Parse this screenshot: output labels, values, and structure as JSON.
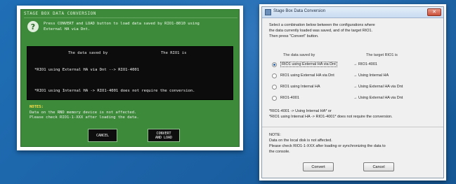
{
  "left_panel": {
    "title": "STAGE BOX DATA CONVERSION",
    "help_icon_glyph": "?",
    "instruction_lines": [
      "Press CONVERT and LOAD button to load data saved by RIO1-8010 using",
      "External HA via Dnt."
    ],
    "col_saved": "The data saved by",
    "col_target": "The RIO1 is",
    "black_lines": [
      "*RIO1 using External HA via Dnt  -->  RIO1-4001",
      "*RIO1 using Internal HA  -> RIO1-4001 does not require the conversion."
    ],
    "notes_heading": "NOTES:",
    "notes": [
      "Data on the RND memory device is not affected.",
      "Please check RIO1-1-XXX after loading the data."
    ],
    "buttons": {
      "cancel": "CANCEL",
      "convert_line1": "CONVERT",
      "convert_line2": "AND LOAD"
    }
  },
  "dialog": {
    "title": "Stage Box Data Conversion",
    "close_glyph": "✕",
    "instruction_lines": [
      "Select a combination below between the configurations where",
      "the data currently loaded was saved, and of the target RIO1.",
      "Then press \"Convert\" button."
    ],
    "col_saved": "The data saved by",
    "col_target": "The target RIO1 is",
    "options": [
      {
        "saved": "RIO1 using External HA via Dnt",
        "target": "→ RIO1-4001",
        "selected": true
      },
      {
        "saved": "RIO1 using External HA via Dnt",
        "target": "→ Using Internal HA",
        "selected": false
      },
      {
        "saved": "RIO1 using Internal HA",
        "target": "→ Using External HA via Dnt",
        "selected": false
      },
      {
        "saved": "RIO1-4001",
        "target": "→ Using External HA via Dnt",
        "selected": false
      }
    ],
    "equation_lines": [
      "*RIO1-4001  ->  Using Internal HA* or",
      "*RIO1 using Internal HA  ->  RIO1-4001* does not require the conversion."
    ],
    "notes_heading": "NOTE:",
    "notes": [
      "Data on the local disk is not affected.",
      "Please check RIO1-1-XXX after loading or synchronizing the data to",
      "the console."
    ],
    "buttons": {
      "convert": "Convert",
      "cancel": "Cancel"
    }
  },
  "colors": {
    "background_blue": "#1c63a7",
    "panel_green": "#3d8a3a",
    "notes_yellow": "#ffe14a",
    "dialog_gray": "#f0f0f0"
  }
}
